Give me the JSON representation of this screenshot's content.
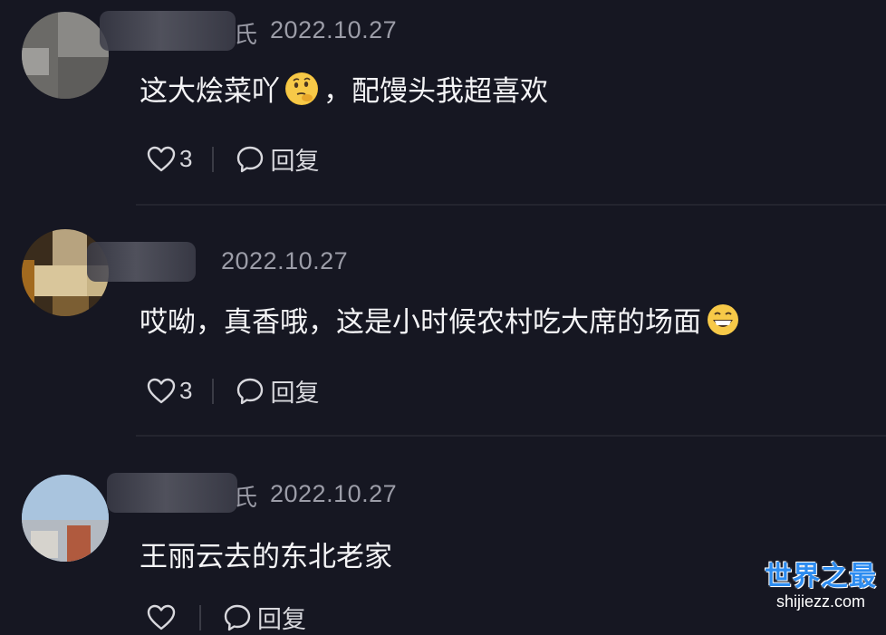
{
  "comments": [
    {
      "date": "2022.10.27",
      "name_tail": "氏",
      "text_a": "这大烩菜吖",
      "text_b": "，配馒头我超喜欢",
      "emoji": "thinking-face-icon",
      "likes": "3",
      "reply_label": "回复"
    },
    {
      "date": "2022.10.27",
      "name_tail": "",
      "text_a": "哎呦，真香哦，这是小时候农村吃大席的场面",
      "text_b": "",
      "emoji": "grinning-face-icon",
      "likes": "3",
      "reply_label": "回复"
    },
    {
      "date": "2022.10.27",
      "name_tail": "氏",
      "text_a": "王丽云去的东北老家",
      "text_b": "",
      "emoji": "",
      "likes": "",
      "reply_label": "回复"
    }
  ],
  "watermark": {
    "title": "世界之最",
    "url": "shijiezz.com"
  },
  "colors": {
    "background": "#161722",
    "text": "#f4f4f6",
    "meta": "#9c9da8",
    "watermark": "#2d8cf0"
  }
}
